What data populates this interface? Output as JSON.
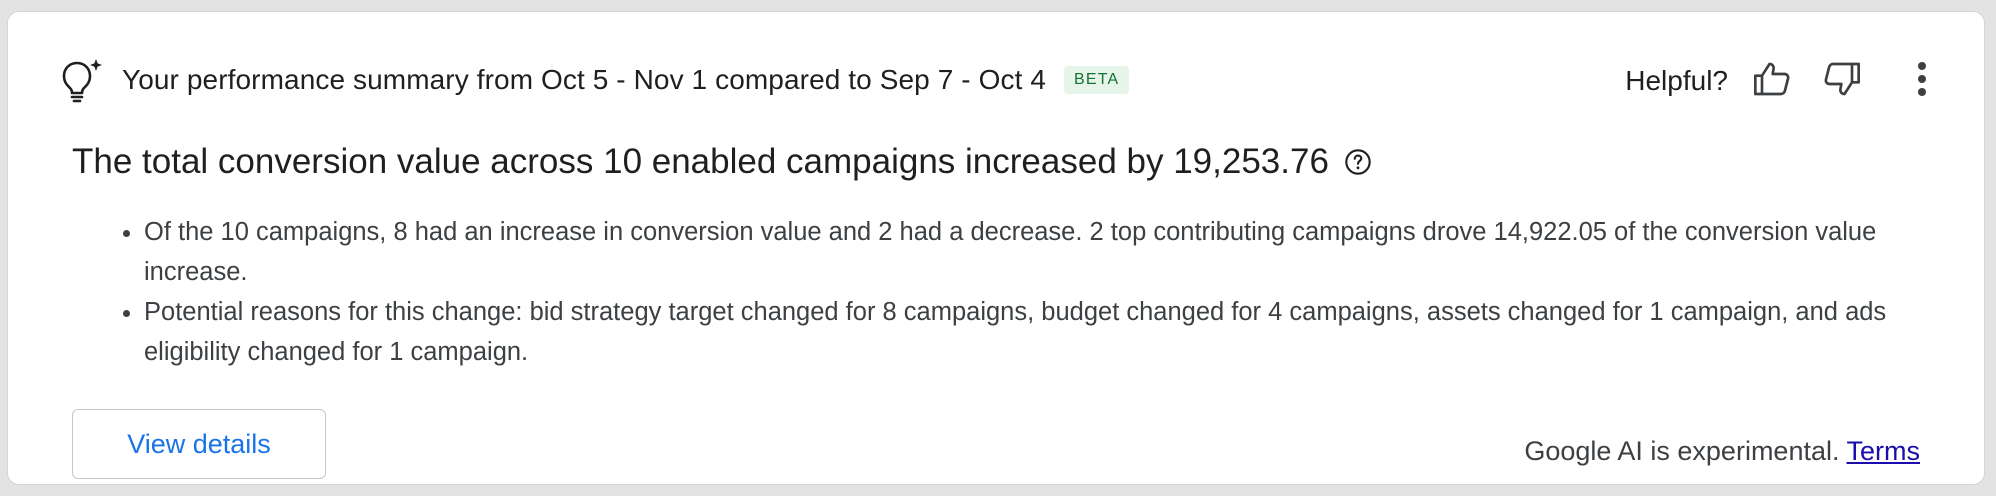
{
  "header": {
    "icon": "lightbulb-sparkle-icon",
    "title": "Your performance summary from Oct 5 - Nov 1 compared to Sep 7 - Oct 4",
    "badge": "BETA"
  },
  "feedback": {
    "label": "Helpful?",
    "thumbs_up_icon": "thumbs-up-icon",
    "thumbs_down_icon": "thumbs-down-icon",
    "more_icon": "more-vert-icon"
  },
  "summary": {
    "headline": "The total conversion value across 10 enabled campaigns increased by 19,253.76",
    "help_icon": "help-circle-icon",
    "bullets": [
      "Of the 10 campaigns, 8 had an increase in conversion value and 2 had a decrease. 2 top contributing campaigns drove 14,922.05 of the conversion value increase.",
      "Potential reasons for this change: bid strategy target changed for 8 campaigns, budget changed for 4 campaigns, assets changed for 1 campaign, and ads eligibility changed for 1 campaign."
    ]
  },
  "actions": {
    "view_details": "View details"
  },
  "footer": {
    "note": "Google AI is experimental.",
    "terms": "Terms"
  },
  "colors": {
    "link_blue": "#1a73e8",
    "terms_link": "#1a0dab",
    "beta_bg": "#e6f4ea",
    "beta_text": "#137333"
  }
}
